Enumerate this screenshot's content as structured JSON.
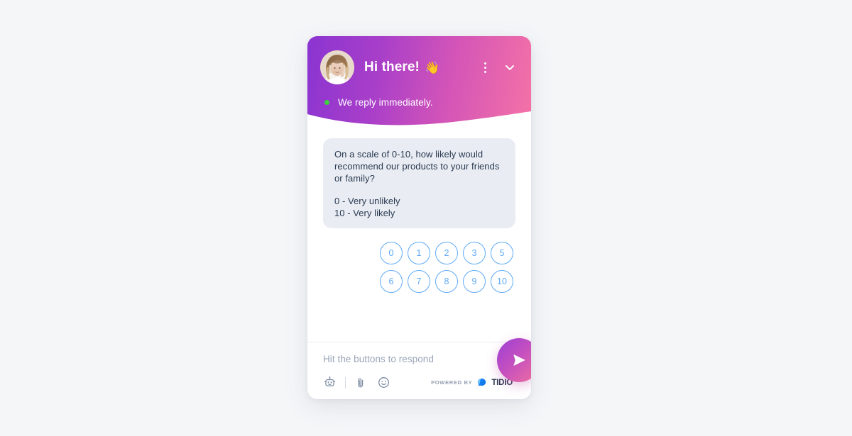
{
  "page": {
    "background_color": "#f5f6f8"
  },
  "widget": {
    "header": {
      "title": "Hi there!",
      "title_emoji": "👋",
      "avatar_alt": "agent-avatar",
      "gradient_from": "#8a34d1",
      "gradient_to": "#f572a6",
      "menu_icon": "vertical-dots-icon",
      "collapse_icon": "chevron-down-icon",
      "status_text": "We reply immediately.",
      "status_dot_color": "#3dd13d"
    },
    "conversation": {
      "message": {
        "question": "On a scale of 0-10, how likely would recommend our products to your friends or family?",
        "legend_low": "0 - Very unlikely",
        "legend_high": "10 - Very likely",
        "bubble_color": "#e9edf3",
        "text_color": "#2b3a52"
      },
      "rating": {
        "accent_color": "#5faaf6",
        "rows": [
          [
            "0",
            "1",
            "2",
            "3",
            "5"
          ],
          [
            "6",
            "7",
            "8",
            "9",
            "10"
          ]
        ]
      }
    },
    "composer": {
      "placeholder": "Hit the buttons to respond",
      "placeholder_color": "#9aa5b8",
      "icons": [
        {
          "name": "bot-icon"
        },
        {
          "name": "attachment-paperclip-icon"
        },
        {
          "name": "emoji-smiley-icon"
        }
      ],
      "send_button": {
        "icon": "send-paper-plane-icon",
        "gradient_from": "#9b40d4",
        "gradient_to": "#f2709c"
      },
      "powered_by": {
        "prefix": "POWERED BY",
        "brand": "TIDIO",
        "brand_color": "#2f3b52",
        "logo_color": "#1a8cff"
      }
    }
  }
}
